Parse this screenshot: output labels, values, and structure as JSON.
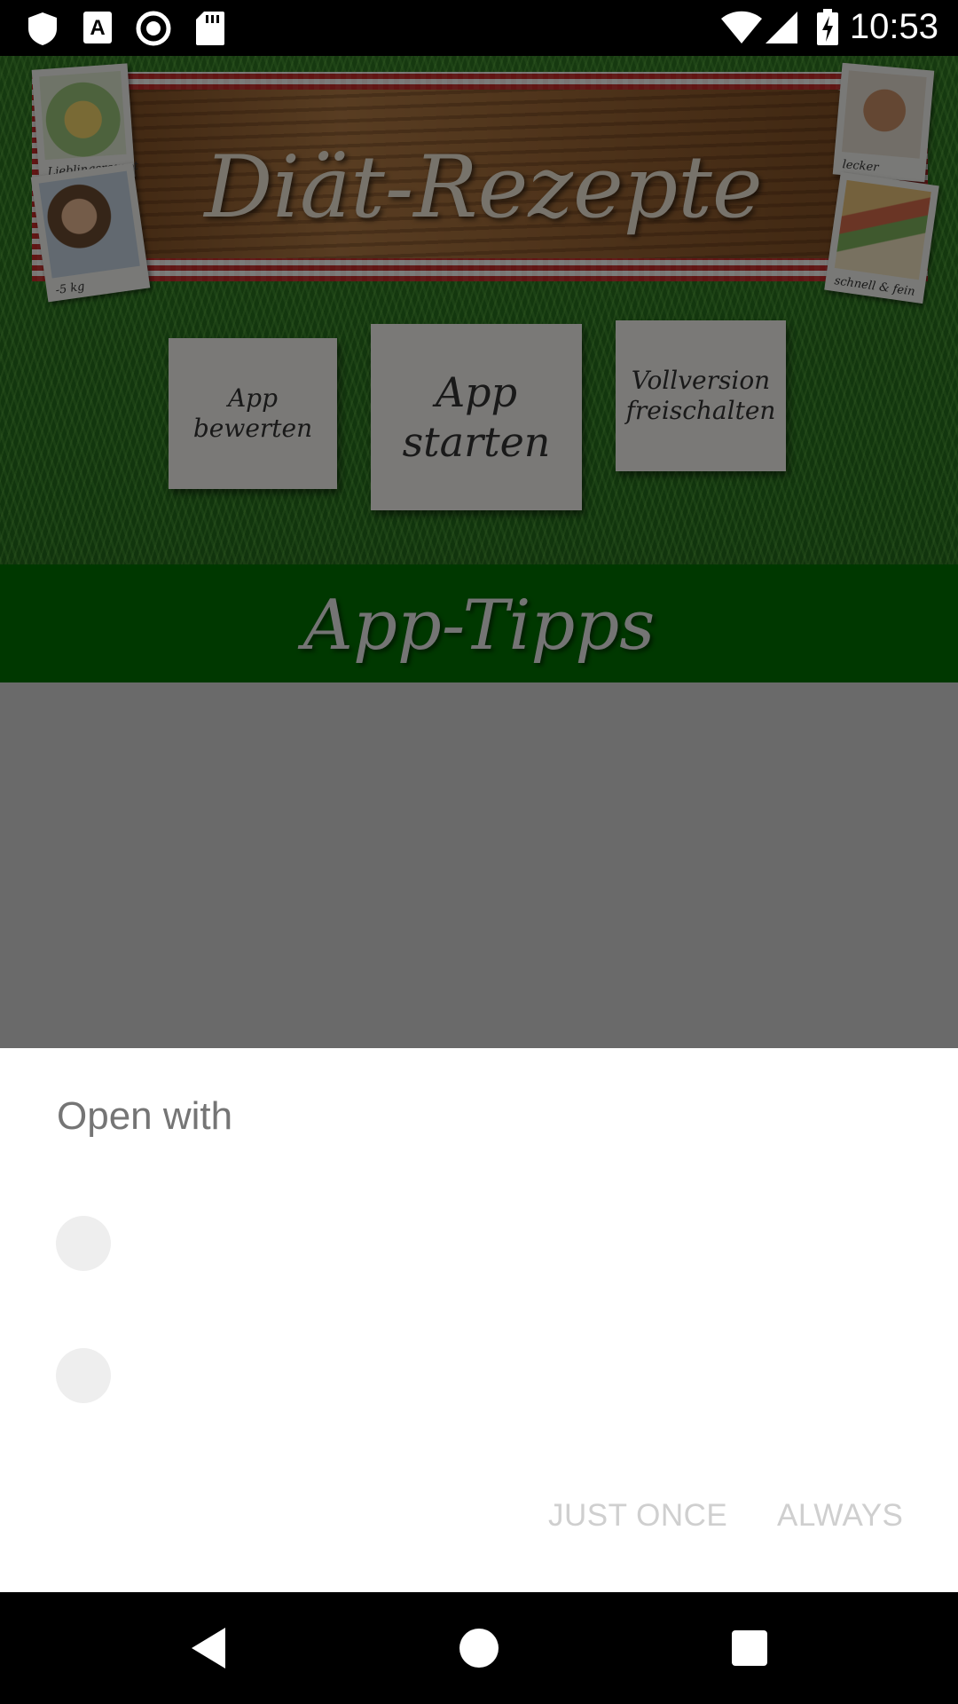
{
  "status_bar": {
    "time": "10:53",
    "icons": [
      "shield-icon",
      "font-a-icon",
      "record-icon",
      "sd-card-icon",
      "wifi-icon",
      "cell-signal-icon",
      "battery-charging-icon"
    ]
  },
  "app": {
    "banner_title": "Diät-Rezepte",
    "photos": {
      "top_left_caption": "Lieblingsrezept",
      "mid_left_caption": "-5 kg",
      "top_right_caption": "lecker",
      "mid_right_caption": "schnell & fein"
    },
    "cards": {
      "rate_line1": "App",
      "rate_line2": "bewerten",
      "start_line1": "App",
      "start_line2": "starten",
      "full_line1": "Vollversion",
      "full_line2": "freischalten"
    },
    "tips_title": "App-Tipps"
  },
  "dialog": {
    "title": "Open with",
    "app_items": [
      {
        "label": ""
      },
      {
        "label": ""
      }
    ],
    "just_once_label": "JUST ONCE",
    "always_label": "ALWAYS"
  },
  "nav_bar": {
    "icons": [
      "back-icon",
      "home-icon",
      "recents-icon"
    ]
  },
  "colors": {
    "grass": "#3f8a2c",
    "tips_bar": "#007000",
    "dialog_title": "#757575",
    "disabled_button": "#cfcfcf",
    "placeholder_icon": "#eeeeee"
  }
}
